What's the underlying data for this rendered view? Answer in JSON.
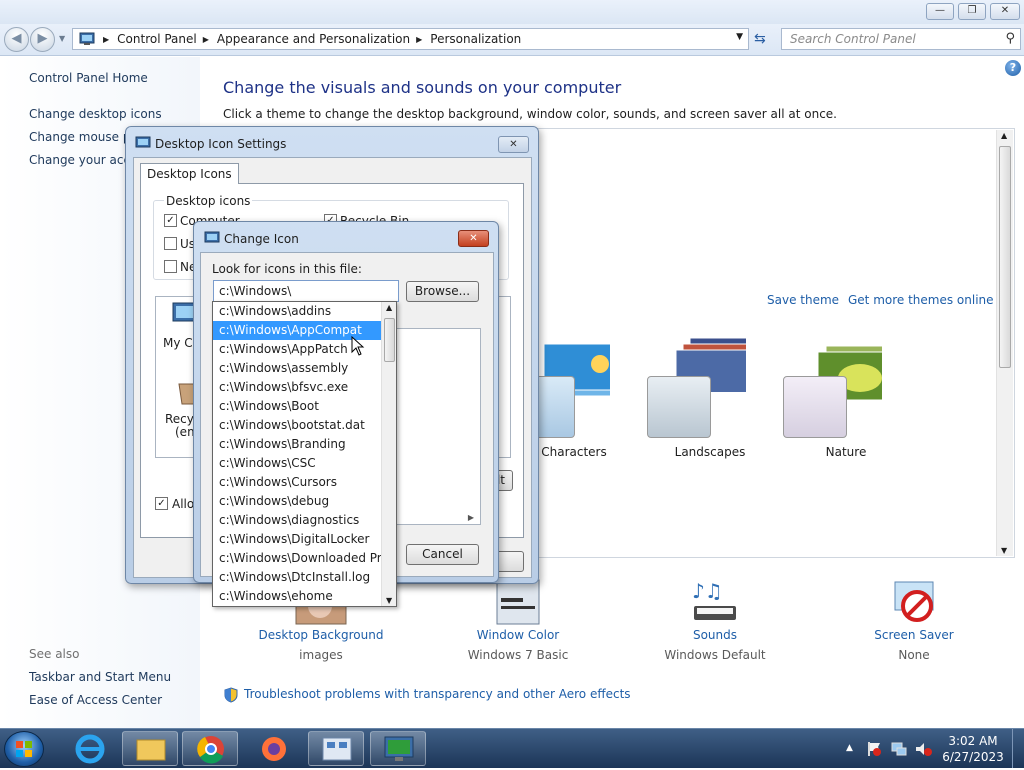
{
  "window": {
    "buttons": {
      "minimize": "—",
      "maximize": "❐",
      "close": "✕"
    }
  },
  "address": {
    "breadcrumbs": [
      "Control Panel",
      "Appearance and Personalization",
      "Personalization"
    ],
    "search_placeholder": "Search Control Panel"
  },
  "sidebar": {
    "home": "Control Panel Home",
    "links": [
      "Change desktop icons",
      "Change mouse po",
      "Change your acco"
    ],
    "see_also_label": "See also",
    "see_also": [
      "Taskbar and Start Menu",
      "Ease of Access Center"
    ]
  },
  "main": {
    "heading": "Change the visuals and sounds on your computer",
    "subtext": "Click a theme to change the desktop background, window color, sounds, and screen saver all at once.",
    "save_theme": "Save theme",
    "get_more_themes": "Get more themes online",
    "themes": [
      "Characters",
      "Landscapes",
      "Nature"
    ],
    "bottom": [
      {
        "label": "Desktop Background",
        "sub": "images"
      },
      {
        "label": "Window Color",
        "sub": "Windows 7 Basic"
      },
      {
        "label": "Sounds",
        "sub": "Windows Default"
      },
      {
        "label": "Screen Saver",
        "sub": "None"
      }
    ],
    "troubleshoot": "Troubleshoot problems with transparency and other Aero effects"
  },
  "desktop_icon_settings": {
    "title": "Desktop Icon Settings",
    "tab": "Desktop Icons",
    "group_label": "Desktop icons",
    "checkboxes": [
      {
        "label": "Computer",
        "checked": true
      },
      {
        "label": "Recycle Bin",
        "checked": true
      },
      {
        "label": "Use",
        "checked": false
      },
      {
        "label": "Ne",
        "checked": false
      }
    ],
    "icon_labels": [
      "My Co",
      "Recyc",
      "(emp"
    ],
    "allow_label": "Allow",
    "allow_checked": true,
    "restore_fragment": "lt"
  },
  "change_icon": {
    "title": "Change Icon",
    "look_label": "Look for icons in this file:",
    "path_value": "c:\\Windows\\",
    "browse": "Browse...",
    "cancel": "Cancel",
    "dropdown_items": [
      "c:\\Windows\\addins",
      "c:\\Windows\\AppCompat",
      "c:\\Windows\\AppPatch",
      "c:\\Windows\\assembly",
      "c:\\Windows\\bfsvc.exe",
      "c:\\Windows\\Boot",
      "c:\\Windows\\bootstat.dat",
      "c:\\Windows\\Branding",
      "c:\\Windows\\CSC",
      "c:\\Windows\\Cursors",
      "c:\\Windows\\debug",
      "c:\\Windows\\diagnostics",
      "c:\\Windows\\DigitalLocker",
      "c:\\Windows\\Downloaded Prog",
      "c:\\Windows\\DtcInstall.log",
      "c:\\Windows\\ehome"
    ],
    "selected_index": 1
  },
  "taskbar": {
    "time": "3:02 AM",
    "date": "6/27/2023"
  },
  "colors": {
    "link": "#1e5ea8",
    "heading": "#1e3287",
    "selection": "#3399ff"
  }
}
